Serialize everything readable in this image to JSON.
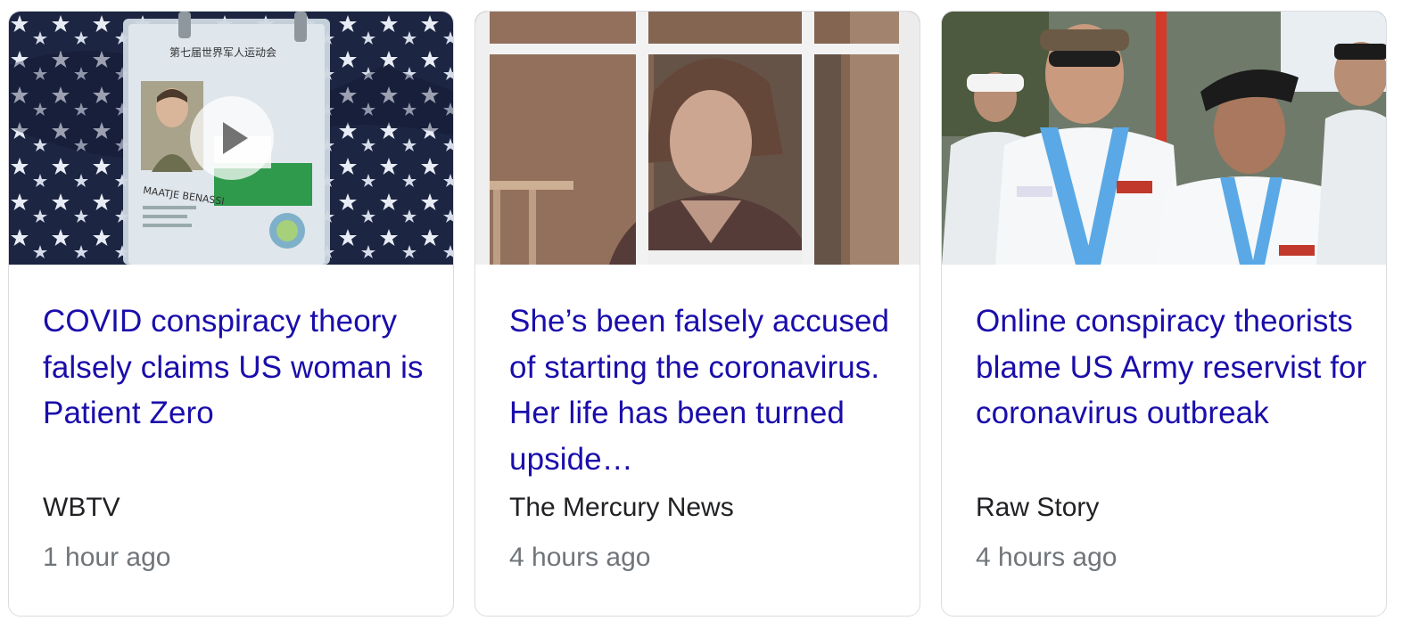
{
  "colors": {
    "headline": "#1a0dab",
    "source": "#202124",
    "timestamp": "#70757a",
    "card_border": "#dadce0"
  },
  "cards": [
    {
      "headline": "COVID conspiracy theory falsely claims US woman is Patient Zero",
      "source": "WBTV",
      "time": "1 hour ago",
      "has_video": true,
      "thumbnail": "id-badge-on-american-flag",
      "badge_text": "MAATJE BENASSI",
      "badge_header": "第七届世界军人运动会"
    },
    {
      "headline": "She’s been falsely accused of starting the coronavirus. Her life has been turned upside…",
      "source": "The Mercury News",
      "time": "4 hours ago",
      "has_video": false,
      "thumbnail": "woman-behind-window"
    },
    {
      "headline": "Online conspiracy theorists blame US Army reservist for coronavirus outbreak",
      "source": "Raw Story",
      "time": "4 hours ago",
      "has_video": false,
      "thumbnail": "two-soldiers-in-white-uniforms"
    }
  ]
}
